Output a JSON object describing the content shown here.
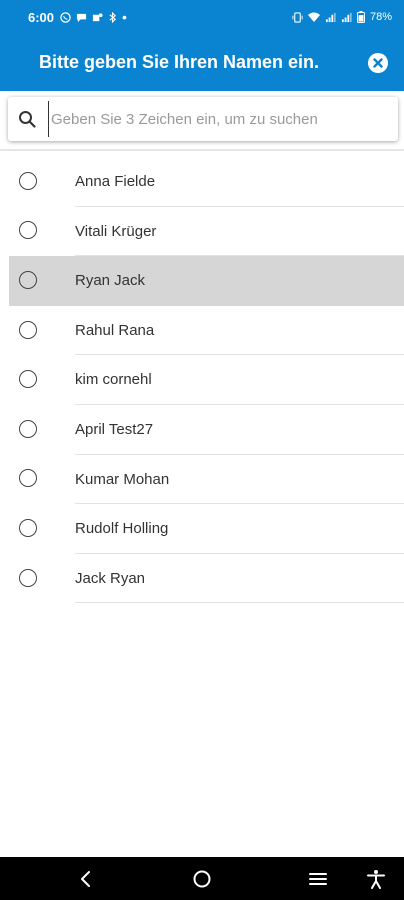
{
  "status_bar": {
    "time": "6:00",
    "battery": "78%",
    "icons": [
      "whatsapp-icon",
      "chat-icon",
      "teams-icon",
      "bluetooth-icon",
      "dot-icon",
      "vibrate-icon",
      "wifi-icon",
      "signal-icon",
      "signal2-icon",
      "battery-icon"
    ]
  },
  "dialog": {
    "title": "Bitte geben Sie Ihren Namen ein.",
    "close_icon": "close-icon"
  },
  "search": {
    "placeholder": "Geben Sie 3 Zeichen ein, um zu suchen",
    "value": ""
  },
  "people": [
    {
      "name": "Anna Fielde",
      "selected": false
    },
    {
      "name": "Vitali Krüger",
      "selected": false
    },
    {
      "name": "Ryan Jack",
      "selected": true
    },
    {
      "name": "Rahul Rana",
      "selected": false
    },
    {
      "name": "kim cornehl",
      "selected": false
    },
    {
      "name": "April Test27",
      "selected": false
    },
    {
      "name": "Kumar Mohan",
      "selected": false
    },
    {
      "name": "Rudolf Holling",
      "selected": false
    },
    {
      "name": "Jack Ryan",
      "selected": false
    }
  ],
  "nav_bar": {
    "buttons": [
      "back-icon",
      "home-icon",
      "recents-icon",
      "accessibility-icon"
    ]
  },
  "colors": {
    "primary": "#0a84d0",
    "highlight": "#d6d6d6",
    "nav_bg": "#000000"
  }
}
